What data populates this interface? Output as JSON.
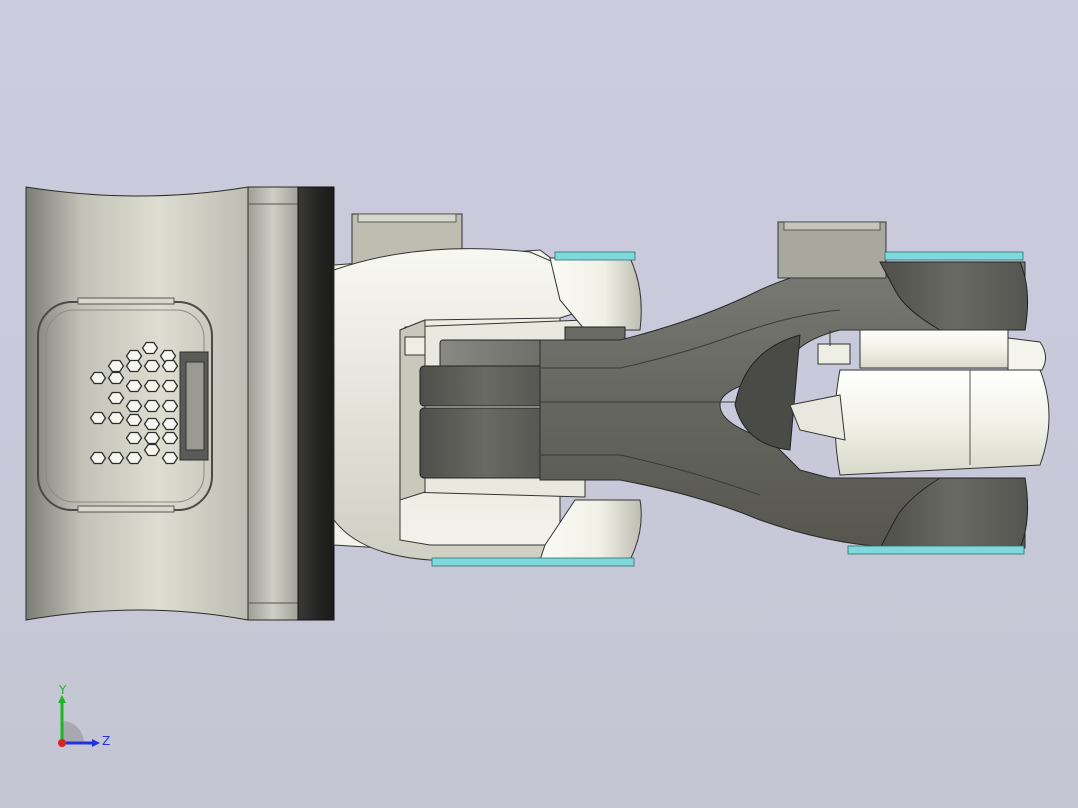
{
  "viewport": {
    "background_top": "#ccccdf",
    "background_bottom": "#c4c6d3"
  },
  "triad": {
    "y_label": "Y",
    "z_label": "Z",
    "y_color": "#22b422",
    "z_color": "#2233dd",
    "x_color": "#dd2222"
  },
  "colors": {
    "metal_light": "#f2f2ea",
    "metal_mid": "#b8b8ae",
    "metal_dark": "#5e5e5a",
    "flange_dark": "#2a2a28",
    "bearing_ring": "#7fd9dc"
  }
}
